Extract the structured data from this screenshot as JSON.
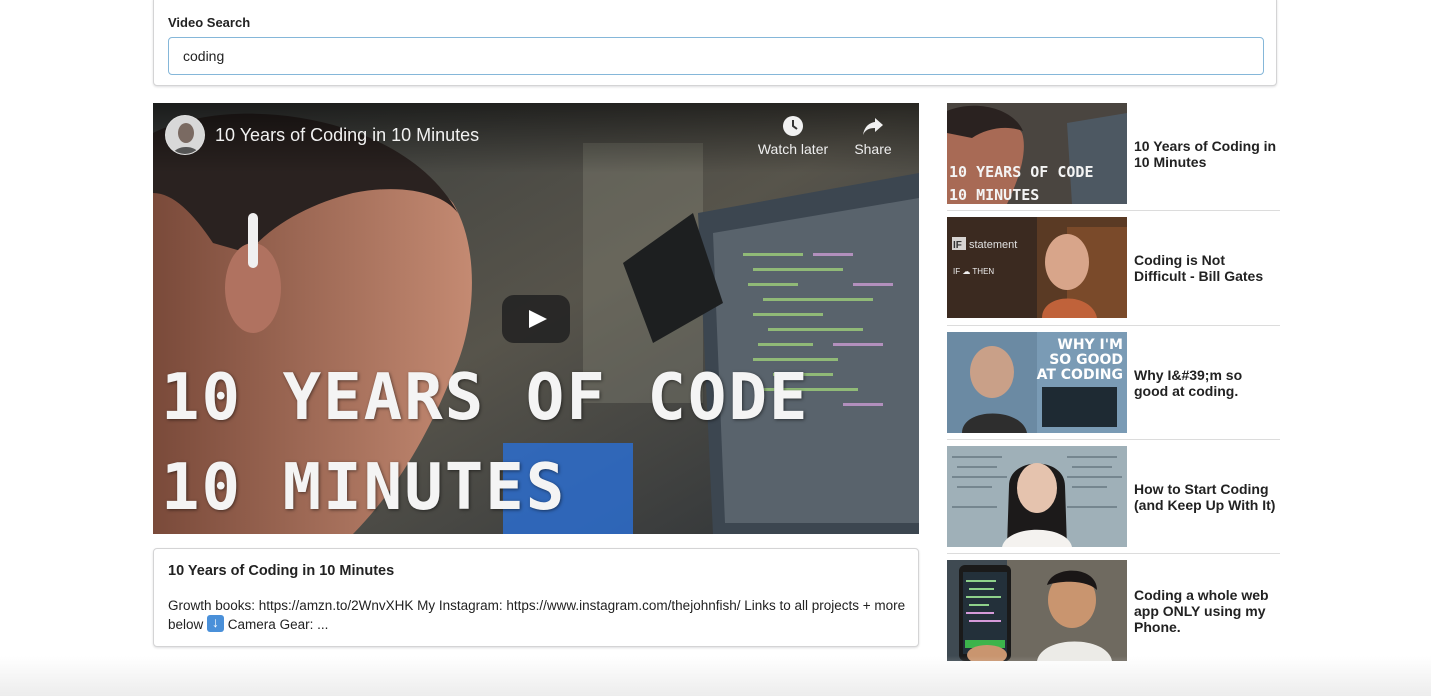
{
  "search": {
    "label": "Video Search",
    "value": "coding"
  },
  "player": {
    "title": "10 Years of Coding in 10 Minutes",
    "watch_later_label": "Watch later",
    "share_label": "Share",
    "overlay_line1": "10 YEARS OF CODE",
    "overlay_line2": "10 MINUTES"
  },
  "detail": {
    "title": "10 Years of Coding in 10 Minutes",
    "description_part1": "Growth books: https://amzn.to/2WnvXHK My Instagram: https://www.instagram.com/thejohnfish/ Links to all projects + more below",
    "description_part2": " Camera Gear: ..."
  },
  "video_list": [
    {
      "title": "10 Years of Coding in 10 Minutes",
      "thumb_text_1": "10 YEARS OF CODE",
      "thumb_text_2": "10 MINUTES"
    },
    {
      "title": "Coding is Not Difficult - Bill Gates",
      "thumb_text_1": "IF statement",
      "thumb_text_2": "IF ☁ THEN"
    },
    {
      "title": "Why I&#39;m so good at coding.",
      "thumb_text_1": "WHY I'M",
      "thumb_text_2": "SO GOOD",
      "thumb_text_3": "AT CODING"
    },
    {
      "title": "How to Start Coding (and Keep Up With It)"
    },
    {
      "title": "Coding a whole web app ONLY using my Phone."
    }
  ]
}
